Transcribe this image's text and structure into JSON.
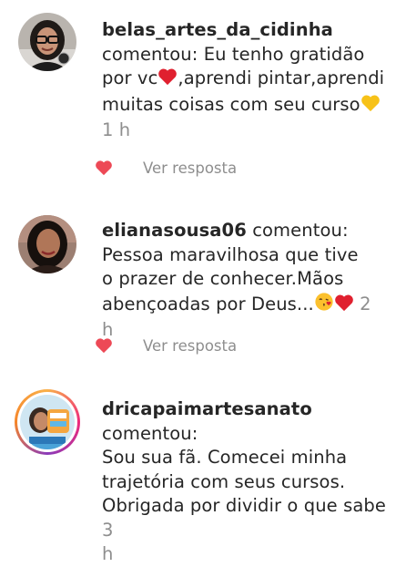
{
  "comments": [
    {
      "username": "belas_artes_da_cidinha",
      "verb": "comentou:",
      "text_1": "Eu tenho gratidão",
      "text_2": "por vc",
      "text_3": ",aprendi pintar,aprendi",
      "text_4": "muitas coisas com seu curso",
      "time": "1 h",
      "reply": "Ver resposta"
    },
    {
      "username": "elianasousa06",
      "verb": "comentou:",
      "text_1": "Pessoa maravilhosa que tive",
      "text_2": "o prazer de conhecer.Mãos",
      "text_3": "abençoadas por Deus...",
      "time": "2 h",
      "reply": "Ver resposta"
    },
    {
      "username": "dricapaimartesanato",
      "verb": "comentou:",
      "text_1": "Sou sua fã.  Comecei minha",
      "text_2": "trajetória com seus cursos.",
      "text_3": "Obrigada por dividir o que sabe",
      "time_1": "3",
      "time_2": "h"
    }
  ],
  "colors": {
    "like_heart": "#ed4956",
    "secondary_text": "#8e8e8e",
    "primary_text": "#262626"
  },
  "icons": [
    "heart-icon",
    "red-heart-emoji",
    "yellow-heart-emoji",
    "kiss-emoji"
  ]
}
